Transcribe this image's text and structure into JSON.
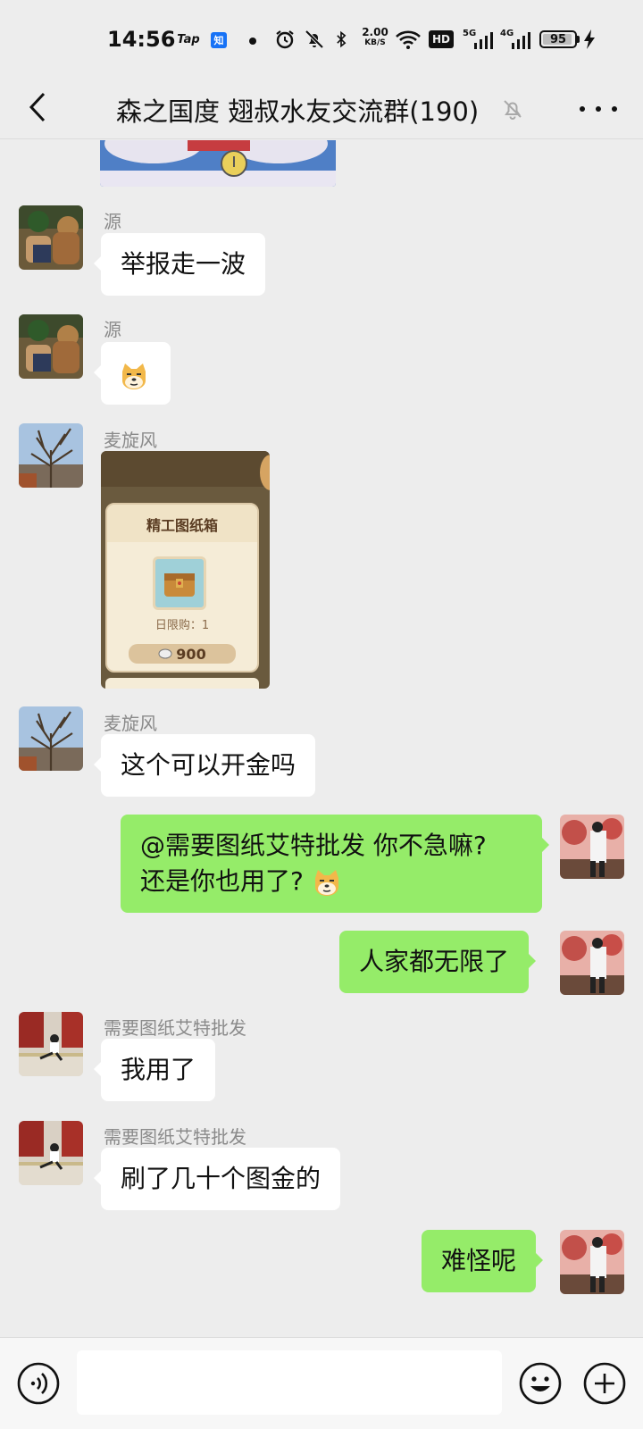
{
  "status": {
    "time": "14:56",
    "tap_label": "Tap",
    "zhi_label": "知",
    "speed_value": "2.00",
    "speed_unit": "KB/S",
    "hd_label": "HD",
    "net1_label": "5G",
    "net2_label": "4G",
    "battery": "95",
    "battery_level": 0.95
  },
  "header": {
    "title": "森之国度 翅叔水友交流群(190)"
  },
  "messages": [
    {
      "sender": "源",
      "text": "举报走一波"
    },
    {
      "sender": "源"
    },
    {
      "sender": "麦旋风",
      "card_title": "精工图纸箱",
      "card_limit": "日限购：1",
      "card_price": "900"
    },
    {
      "sender": "麦旋风",
      "text": "这个可以开金吗"
    },
    {
      "line1": "@需要图纸艾特批发  你不急嘛?",
      "line2": "还是你也用了?"
    },
    {
      "text": "人家都无限了"
    },
    {
      "sender": "需要图纸艾特批发",
      "text": "我用了"
    },
    {
      "sender": "需要图纸艾特批发",
      "text": "刷了几十个图金的"
    },
    {
      "text": "难怪呢"
    }
  ],
  "input": {
    "value": "",
    "placeholder": ""
  },
  "colors": {
    "outgoing_bubble": "#95ec69",
    "incoming_bubble": "#ffffff",
    "background": "#ededed"
  }
}
